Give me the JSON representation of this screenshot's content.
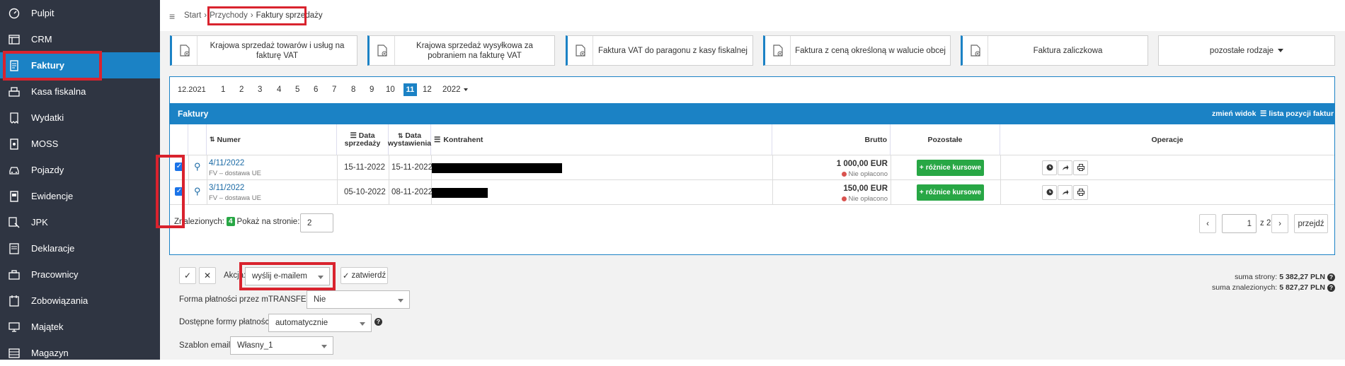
{
  "sidebar": {
    "items": [
      {
        "label": "Pulpit",
        "icon": "dashboard-icon"
      },
      {
        "label": "CRM",
        "icon": "crm-icon"
      },
      {
        "label": "Faktury",
        "icon": "invoice-icon",
        "active": true
      },
      {
        "label": "Kasa fiskalna",
        "icon": "cash-register-icon"
      },
      {
        "label": "Wydatki",
        "icon": "expenses-icon"
      },
      {
        "label": "MOSS",
        "icon": "moss-icon"
      },
      {
        "label": "Pojazdy",
        "icon": "car-icon"
      },
      {
        "label": "Ewidencje",
        "icon": "records-icon"
      },
      {
        "label": "JPK",
        "icon": "jpk-icon"
      },
      {
        "label": "Deklaracje",
        "icon": "declarations-icon"
      },
      {
        "label": "Pracownicy",
        "icon": "employees-icon"
      },
      {
        "label": "Zobowiązania",
        "icon": "liabilities-icon"
      },
      {
        "label": "Majątek",
        "icon": "assets-icon"
      },
      {
        "label": "Magazyn",
        "icon": "warehouse-icon"
      }
    ]
  },
  "breadcrumb": {
    "start": "Start",
    "sep": "›",
    "przychody": "Przychody",
    "current": "Faktury sprzedaży"
  },
  "doc_types": [
    "Krajowa sprzedaż towarów i usług na fakturę VAT",
    "Krajowa sprzedaż wysyłkowa za pobraniem na fakturę VAT",
    "Faktura VAT do paragonu z kasy fiskalnej",
    "Faktura z ceną określoną w walucie obcej",
    "Faktura zaliczkowa"
  ],
  "other_types": "pozostałe rodzaje",
  "months": {
    "prev": "12.2021",
    "list": [
      "1",
      "2",
      "3",
      "4",
      "5",
      "6",
      "7",
      "8",
      "9",
      "10",
      "11",
      "12"
    ],
    "active": "11",
    "year": "2022"
  },
  "table": {
    "title": "Faktury",
    "change_view": "zmień widok",
    "positions_list": "lista pozycji faktur",
    "headers": {
      "numer": "Numer",
      "data_sprzedazy_1": "Data",
      "data_sprzedazy_2": "sprzedaży",
      "data_wystawienia_1": "Data",
      "data_wystawienia_2": "wystawienia",
      "kontrahent": "Kontrahent",
      "brutto": "Brutto",
      "pozostale": "Pozostałe",
      "operacje": "Operacje"
    },
    "rows": [
      {
        "number": "4/11/2022",
        "type": "FV – dostawa UE",
        "sale_date": "15-11-2022",
        "issue_date": "15-11-2022",
        "gross": "1 000,00 EUR",
        "status": "Nie opłacono",
        "other": "różnice kursowe"
      },
      {
        "number": "3/11/2022",
        "type": "FV – dostawa UE",
        "sale_date": "05-10-2022",
        "issue_date": "08-11-2022",
        "gross": "150,00 EUR",
        "status": "Nie opłacono",
        "other": "różnice kursowe"
      }
    ],
    "found_label": "Znalezionych:",
    "found_count": "4",
    "per_page_label": "Pokaż na stronie:",
    "per_page": "2",
    "page": "1",
    "of_pages": "z 2",
    "go": "przejdź"
  },
  "actions": {
    "label": "Akcja:",
    "selected": "wyślij e-mailem",
    "confirm": "zatwierdź",
    "mtransfer_label": "Forma płatności przez mTRANSFER",
    "mtransfer_value": "Nie",
    "payment_forms_label": "Dostępne formy płatności",
    "payment_forms_value": "automatycznie",
    "email_template_label": "Szablon email",
    "email_template_value": "Własny_1"
  },
  "sums": {
    "page_label": "suma strony:",
    "page_value": "5 382,27 PLN",
    "found_label": "suma znalezionych:",
    "found_value": "5 827,27 PLN"
  },
  "colors": {
    "accent": "#1b82c5",
    "sidebar": "#2f3542",
    "highlight": "#d9232e",
    "green": "#28a745",
    "unpaid": "#d9534f"
  }
}
